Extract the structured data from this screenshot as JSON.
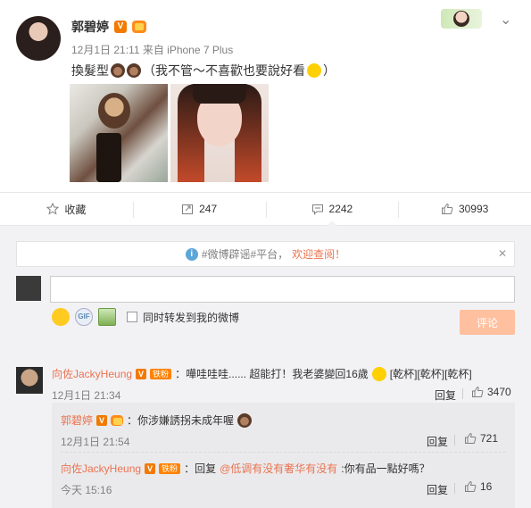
{
  "post": {
    "author": "郭碧婷",
    "meta": "12月1日 21:11 来自 iPhone 7 Plus",
    "text_before": "換髮型",
    "text_after": "（我不管～不喜歡也要說好看",
    "text_end": "）"
  },
  "actions": {
    "favorite": "收藏",
    "repost": "247",
    "comment": "2242",
    "like": "30993"
  },
  "notice": {
    "prefix": "#微博辟谣#平台，",
    "highlight": "欢迎查阅！"
  },
  "composer": {
    "share_label": "同时转发到我的微博",
    "submit_label": "评论",
    "gif_label": "GIF"
  },
  "comments": [
    {
      "user": "向佐JackyHeung",
      "fan_label": "铁粉",
      "text": "：嘩哇哇哇...... 超能打！我老婆變回16歲",
      "suffix": "[乾杯][乾杯][乾杯]",
      "time": "12月1日 21:34",
      "reply": "回复",
      "likes": "3470"
    }
  ],
  "replies": [
    {
      "user": "郭碧婷",
      "text": "：你涉嫌誘拐未成年喔",
      "time": "12月1日 21:54",
      "reply": "回复",
      "likes": "721"
    },
    {
      "user": "向佐JackyHeung",
      "fan_label": "铁粉",
      "text_prefix": "：回复",
      "mention": "@低调有没有奢华有没有",
      "text_suffix": ":你有品一點好嗎？",
      "time": "今天 15:16",
      "reply": "回复",
      "likes": "16"
    }
  ],
  "colors": {
    "accent": "#eb7350",
    "background_gray": "#f2f2f5",
    "badge_orange": "#f27a00",
    "submit_disabled": "#ffc09f"
  }
}
